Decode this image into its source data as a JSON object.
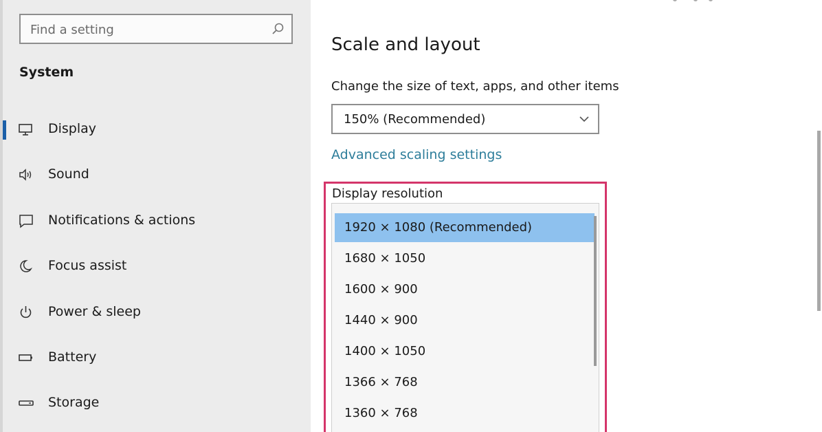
{
  "search": {
    "placeholder": "Find a setting"
  },
  "sidebar": {
    "section_title": "System",
    "items": [
      {
        "label": "Display",
        "icon": "monitor-icon",
        "active": true
      },
      {
        "label": "Sound",
        "icon": "speaker-icon"
      },
      {
        "label": "Notifications & actions",
        "icon": "message-icon"
      },
      {
        "label": "Focus assist",
        "icon": "moon-icon"
      },
      {
        "label": "Power & sleep",
        "icon": "power-icon"
      },
      {
        "label": "Battery",
        "icon": "battery-icon"
      },
      {
        "label": "Storage",
        "icon": "storage-icon"
      }
    ]
  },
  "main": {
    "section_title": "Scale and layout",
    "scale_label": "Change the size of text, apps, and other items",
    "scale_value": "150% (Recommended)",
    "advanced_link": "Advanced scaling settings",
    "resolution_label": "Display resolution",
    "resolution_options": [
      "1920 × 1080 (Recommended)",
      "1680 × 1050",
      "1600 × 900",
      "1440 × 900",
      "1400 × 1050",
      "1366 × 768",
      "1360 × 768"
    ],
    "resolution_selected": "1920 × 1080 (Recommended)"
  },
  "colors": {
    "accent": "#1a5fa8",
    "link": "#2d7d9a",
    "highlight_border": "#d4356a",
    "selected_option": "#8ec1ee"
  }
}
